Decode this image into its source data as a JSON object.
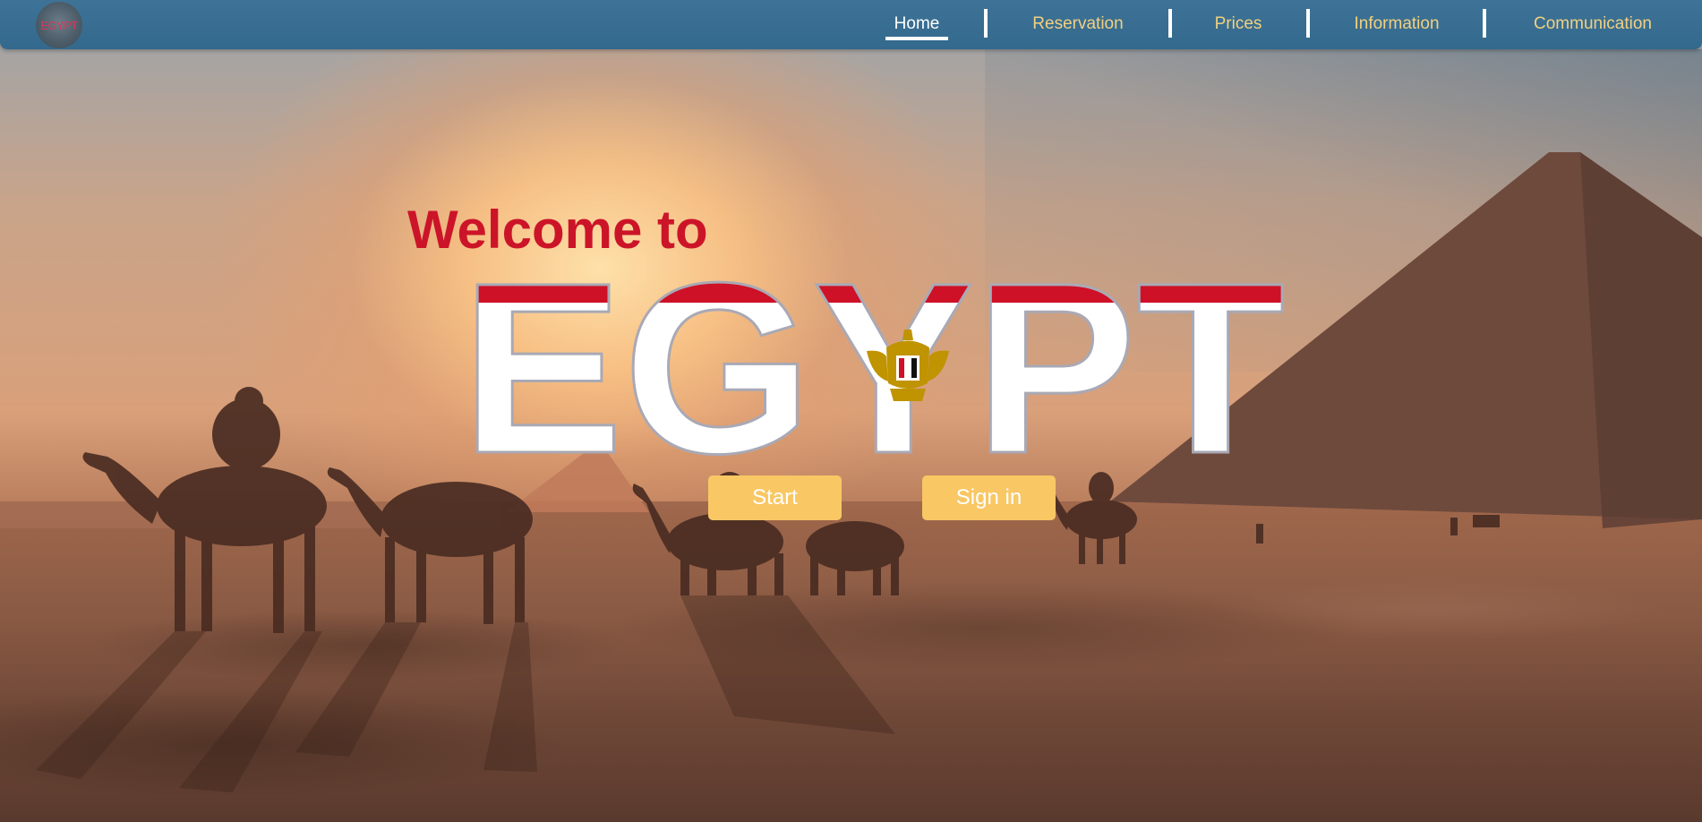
{
  "logo": {
    "text": "EGYPT"
  },
  "nav": {
    "items": [
      {
        "label": "Home",
        "active": true
      },
      {
        "label": "Reservation",
        "active": false
      },
      {
        "label": "Prices",
        "active": false
      },
      {
        "label": "Information",
        "active": false
      },
      {
        "label": "Communication",
        "active": false
      }
    ]
  },
  "hero": {
    "welcome": "Welcome to",
    "title": "EGYPT",
    "start_label": "Start",
    "signin_label": "Sign in"
  },
  "colors": {
    "nav_bg": "#3a6f93",
    "nav_text": "#f2d080",
    "accent_red": "#cc1429",
    "button_bg": "#f9c764",
    "flag_red": "#ce1126",
    "flag_white": "#ffffff",
    "flag_black": "#000000",
    "eagle_gold": "#c09300"
  },
  "icons": {
    "logo": "egypt-globe-logo",
    "emblem": "eagle-of-saladin-icon"
  }
}
